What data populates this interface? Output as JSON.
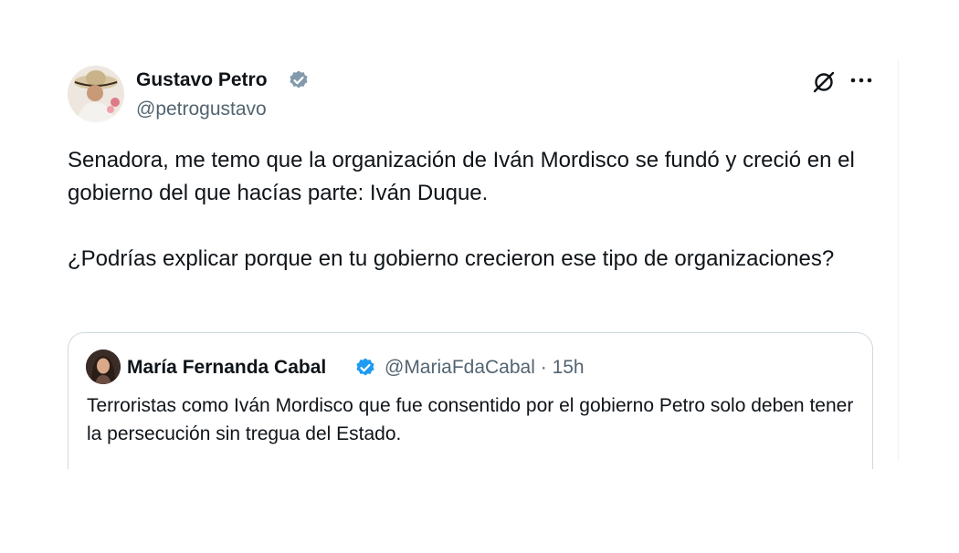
{
  "tweet": {
    "author_name": "Gustavo Petro",
    "handle": "@petrogustavo",
    "paragraphs": [
      "Senadora, me temo que la organización de Iván Mordisco se fundó y creció en el gobierno del que hacías parte: Iván Duque.",
      "¿Podrías explicar porque en tu gobierno crecieron ese tipo de organizaciones?"
    ]
  },
  "quoted_tweet": {
    "author_name": "María Fernanda Cabal",
    "handle": "@MariaFdaCabal",
    "separator": "·",
    "time": "15h",
    "text": "Terroristas como Iván Mordisco que fue consentido por el gobierno Petro solo deben tener la persecución sin tregua del Estado."
  },
  "icons": [
    "verified-badge-icon",
    "grok-icon",
    "more-options-icon"
  ],
  "colors": {
    "verified": "#1d9bf0",
    "muted_text": "#536471",
    "border": "#cfd9de"
  }
}
